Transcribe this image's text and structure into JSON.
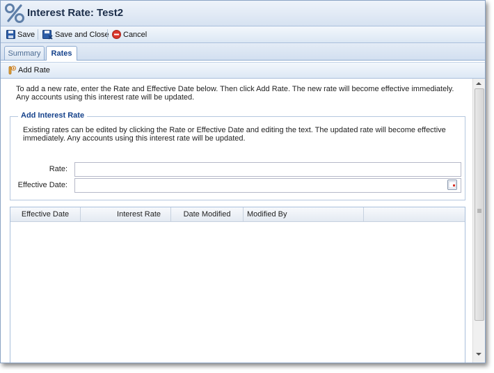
{
  "window": {
    "title": "Interest Rate: Test2"
  },
  "toolbar": {
    "save_label": "Save",
    "save_close_label": "Save and Close",
    "cancel_label": "Cancel"
  },
  "tabs": [
    {
      "label": "Summary",
      "active": false
    },
    {
      "label": "Rates",
      "active": true
    }
  ],
  "actions": {
    "add_rate_label": "Add Rate"
  },
  "intro_text": "To add a new rate, enter the Rate and Effective Date below. Then click Add Rate. The new rate will become effective immediately. Any accounts using this interest rate will be updated.",
  "form": {
    "legend": "Add Interest Rate",
    "description": "Existing rates can be edited by clicking the Rate or Effective Date and editing the text. The updated rate will become effective immediately. Any accounts using this interest rate will be updated.",
    "rate_label": "Rate:",
    "rate_value": "",
    "effective_date_label": "Effective Date:",
    "effective_date_value": ""
  },
  "grid": {
    "columns": [
      "Effective Date",
      "Interest Rate",
      "Date Modified",
      "Modified By"
    ],
    "rows": []
  },
  "colors": {
    "accent": "#15428b",
    "header_gradient_top": "#eef3fa",
    "header_gradient_bottom": "#d6e2f1",
    "cancel_red": "#d9362b"
  }
}
